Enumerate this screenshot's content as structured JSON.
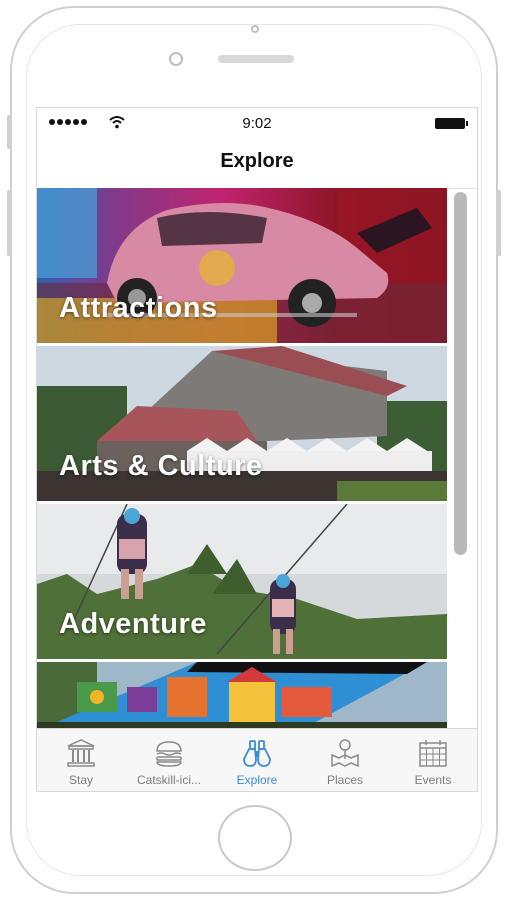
{
  "status_bar": {
    "time": "9:02"
  },
  "nav": {
    "title": "Explore"
  },
  "feed": {
    "tiles": [
      {
        "label": "Attractions"
      },
      {
        "label": "Arts & Culture"
      },
      {
        "label": "Adventure"
      },
      {
        "label": ""
      }
    ]
  },
  "tab_bar": {
    "active": "Explore",
    "active_color": "#3a8ddb",
    "inactive_color": "#7d7d7d",
    "tabs": [
      {
        "label": "Stay",
        "icon": "building-icon"
      },
      {
        "label": "Catskill-ici...",
        "icon": "burger-icon"
      },
      {
        "label": "Explore",
        "icon": "binoculars-icon"
      },
      {
        "label": "Places",
        "icon": "map-pin-icon"
      },
      {
        "label": "Events",
        "icon": "calendar-icon"
      }
    ]
  }
}
